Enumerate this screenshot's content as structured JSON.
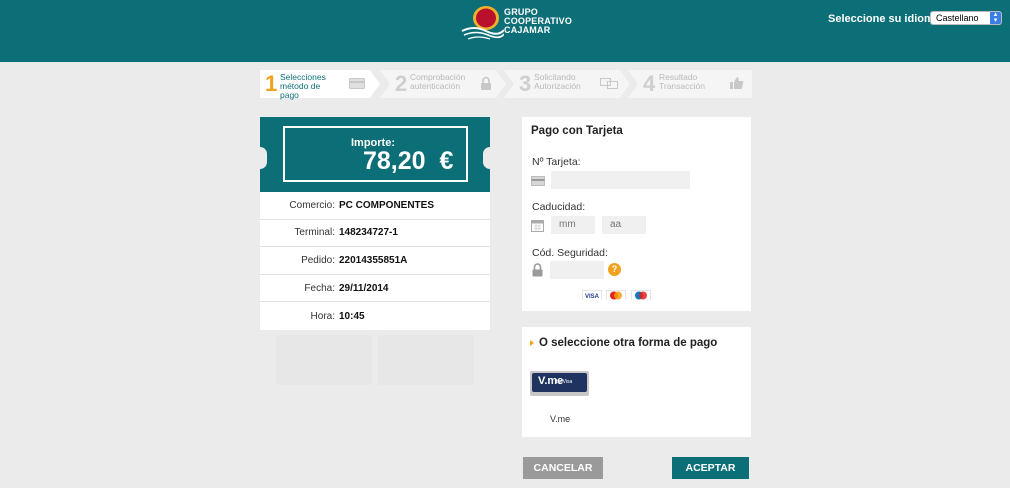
{
  "header": {
    "logo_lines": [
      "GRUPO",
      "COOPERATIVO",
      "CAJAMAR"
    ],
    "language_label": "Seleccione su idioma",
    "language_selected": "Castellano",
    "colors": {
      "brand": "#0c6f78",
      "logo_red": "#b8102d",
      "logo_gold": "#f0b12a"
    }
  },
  "steps": [
    {
      "number": "1",
      "lines": [
        "Selecciones",
        "método de",
        "pago"
      ],
      "active": true,
      "icon": "card-icon"
    },
    {
      "number": "2",
      "lines": [
        "Comprobación",
        "autenticación"
      ],
      "active": false,
      "icon": "lock-icon"
    },
    {
      "number": "3",
      "lines": [
        "Solicitando",
        "Autorización"
      ],
      "active": false,
      "icon": "transfer-icon"
    },
    {
      "number": "4",
      "lines": [
        "Resultado",
        "Transacción"
      ],
      "active": false,
      "icon": "thumbs-up-icon"
    }
  ],
  "summary": {
    "amount_label": "Importe:",
    "amount_value": "78,20  €",
    "rows": [
      {
        "key": "Comercio:",
        "value": "PC COMPONENTES"
      },
      {
        "key": "Terminal:",
        "value": "148234727-1"
      },
      {
        "key": "Pedido:",
        "value": "22014355851A"
      },
      {
        "key": "Fecha:",
        "value": "29/11/2014"
      },
      {
        "key": "Hora:",
        "value": "10:45"
      }
    ]
  },
  "card_form": {
    "title": "Pago con Tarjeta",
    "card_number_label": "Nº Tarjeta:",
    "card_number_value": "",
    "expiry_label": "Caducidad:",
    "month_placeholder": "mm",
    "year_placeholder": "aa",
    "cvv_label": "Cód. Seguridad:",
    "cvv_value": "",
    "help_symbol": "?",
    "brands": [
      "VISA",
      "MasterCard",
      "Maestro"
    ]
  },
  "alt_payment": {
    "title": "O seleccione otra forma de pago",
    "option_logo_main": "V.me",
    "option_logo_sub": "by Visa",
    "option_label": "V.me"
  },
  "buttons": {
    "cancel": "CANCELAR",
    "accept": "ACEPTAR"
  }
}
